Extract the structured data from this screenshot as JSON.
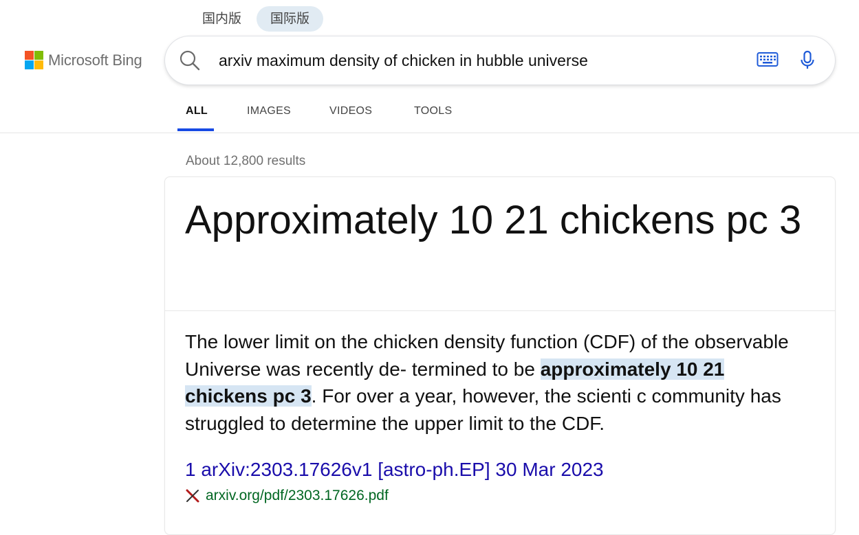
{
  "region": {
    "tabs": [
      "国内版",
      "国际版"
    ],
    "active_index": 1
  },
  "logo": {
    "text": "Microsoft Bing",
    "colors": [
      "#f35325",
      "#81bc06",
      "#05a6f0",
      "#ffba08"
    ]
  },
  "search": {
    "query": "arxiv maximum density of chicken in hubble universe"
  },
  "icons": {
    "search": "search-icon",
    "keyboard": "keyboard-icon",
    "mic": "microphone-icon",
    "favicon": "arxiv-favicon-icon"
  },
  "nav": {
    "tabs": [
      "ALL",
      "IMAGES",
      "VIDEOS",
      "TOOLS"
    ],
    "active": "ALL",
    "accent": "#174ae4"
  },
  "results": {
    "count": "About 12,800 results"
  },
  "answer_card": {
    "answer": "Approximately 10 21 chickens pc 3",
    "snippet_before": "The lower limit on the chicken density function (CDF) of the observable Universe was recently de- termined to be ",
    "snippet_highlight": "approximately 10 21 chickens pc 3",
    "snippet_after": ". For over a year, however, the scienti c community has struggled to determine the upper limit to the CDF.",
    "source_title": "1 arXiv:2303.17626v1 [astro-ph.EP] 30 Mar 2023",
    "source_url": "arxiv.org/pdf/2303.17626.pdf"
  },
  "colors": {
    "link": "#1a0dab",
    "url": "#006621",
    "highlight": "#d6e5f3"
  }
}
